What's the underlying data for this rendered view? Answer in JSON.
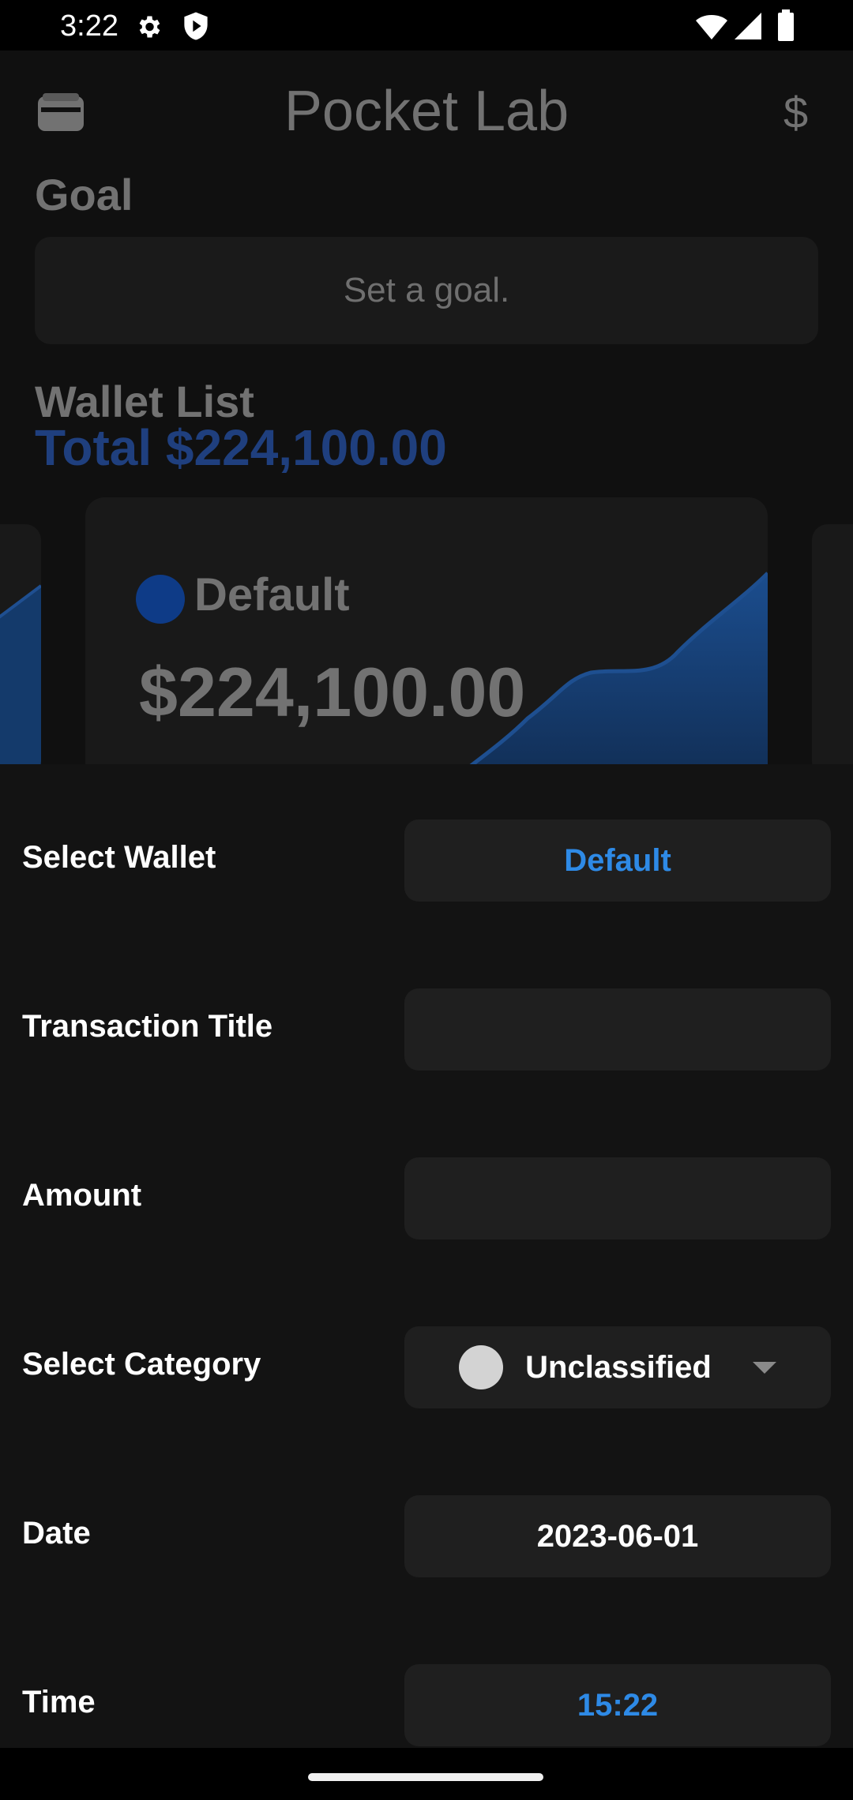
{
  "status_bar": {
    "time": "3:22",
    "icons": [
      "gear-icon",
      "shield-icon",
      "wifi-icon",
      "signal-icon",
      "battery-icon"
    ]
  },
  "app": {
    "title": "Pocket Lab",
    "left_icon": "wallet-icon",
    "right_icon": "$",
    "goal": {
      "heading": "Goal",
      "placeholder": "Set a goal."
    },
    "wallet_list": {
      "heading": "Wallet List",
      "total": "Total $224,100.00",
      "cards": [
        {
          "name": "Default",
          "balance": "$224,100.00"
        }
      ]
    }
  },
  "form": {
    "select_wallet": {
      "label": "Select Wallet",
      "value": "Default"
    },
    "transaction_title": {
      "label": "Transaction Title",
      "value": ""
    },
    "amount": {
      "label": "Amount",
      "value": ""
    },
    "select_category": {
      "label": "Select Category",
      "value": "Unclassified"
    },
    "date": {
      "label": "Date",
      "value": "2023-06-01"
    },
    "time": {
      "label": "Time",
      "value": "15:22"
    }
  },
  "colors": {
    "accent_blue": "#2e8ae6",
    "total_blue": "#1f3f7e",
    "sheet_bg": "#131313",
    "field_bg": "#1f1f1f"
  }
}
